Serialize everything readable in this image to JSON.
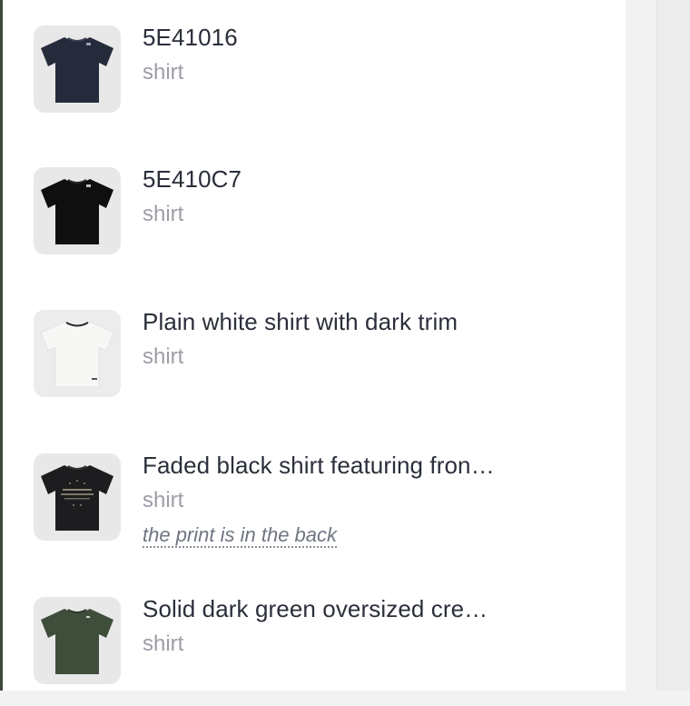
{
  "items": [
    {
      "title": "5E41016",
      "subtitle": "shirt",
      "shirt_color": "#262b3c",
      "thumbnail_icon": "navy-tshirt-icon"
    },
    {
      "title": "5E410C7",
      "subtitle": "shirt",
      "shirt_color": "#0f0f10",
      "thumbnail_icon": "black-tshirt-icon"
    },
    {
      "title": "Plain white shirt with dark trim",
      "subtitle": "shirt",
      "shirt_color": "#f7f7f5",
      "thumbnail_icon": "white-tshirt-icon"
    },
    {
      "title": "Faded black shirt featuring fron…",
      "subtitle": "shirt",
      "note": "the print is in the back",
      "shirt_color": "#1d1d1f",
      "thumbnail_icon": "printed-black-tshirt-icon"
    },
    {
      "title": "Solid dark green oversized cre…",
      "subtitle": "shirt",
      "shirt_color": "#3f4e3b",
      "thumbnail_icon": "green-tshirt-icon"
    }
  ]
}
